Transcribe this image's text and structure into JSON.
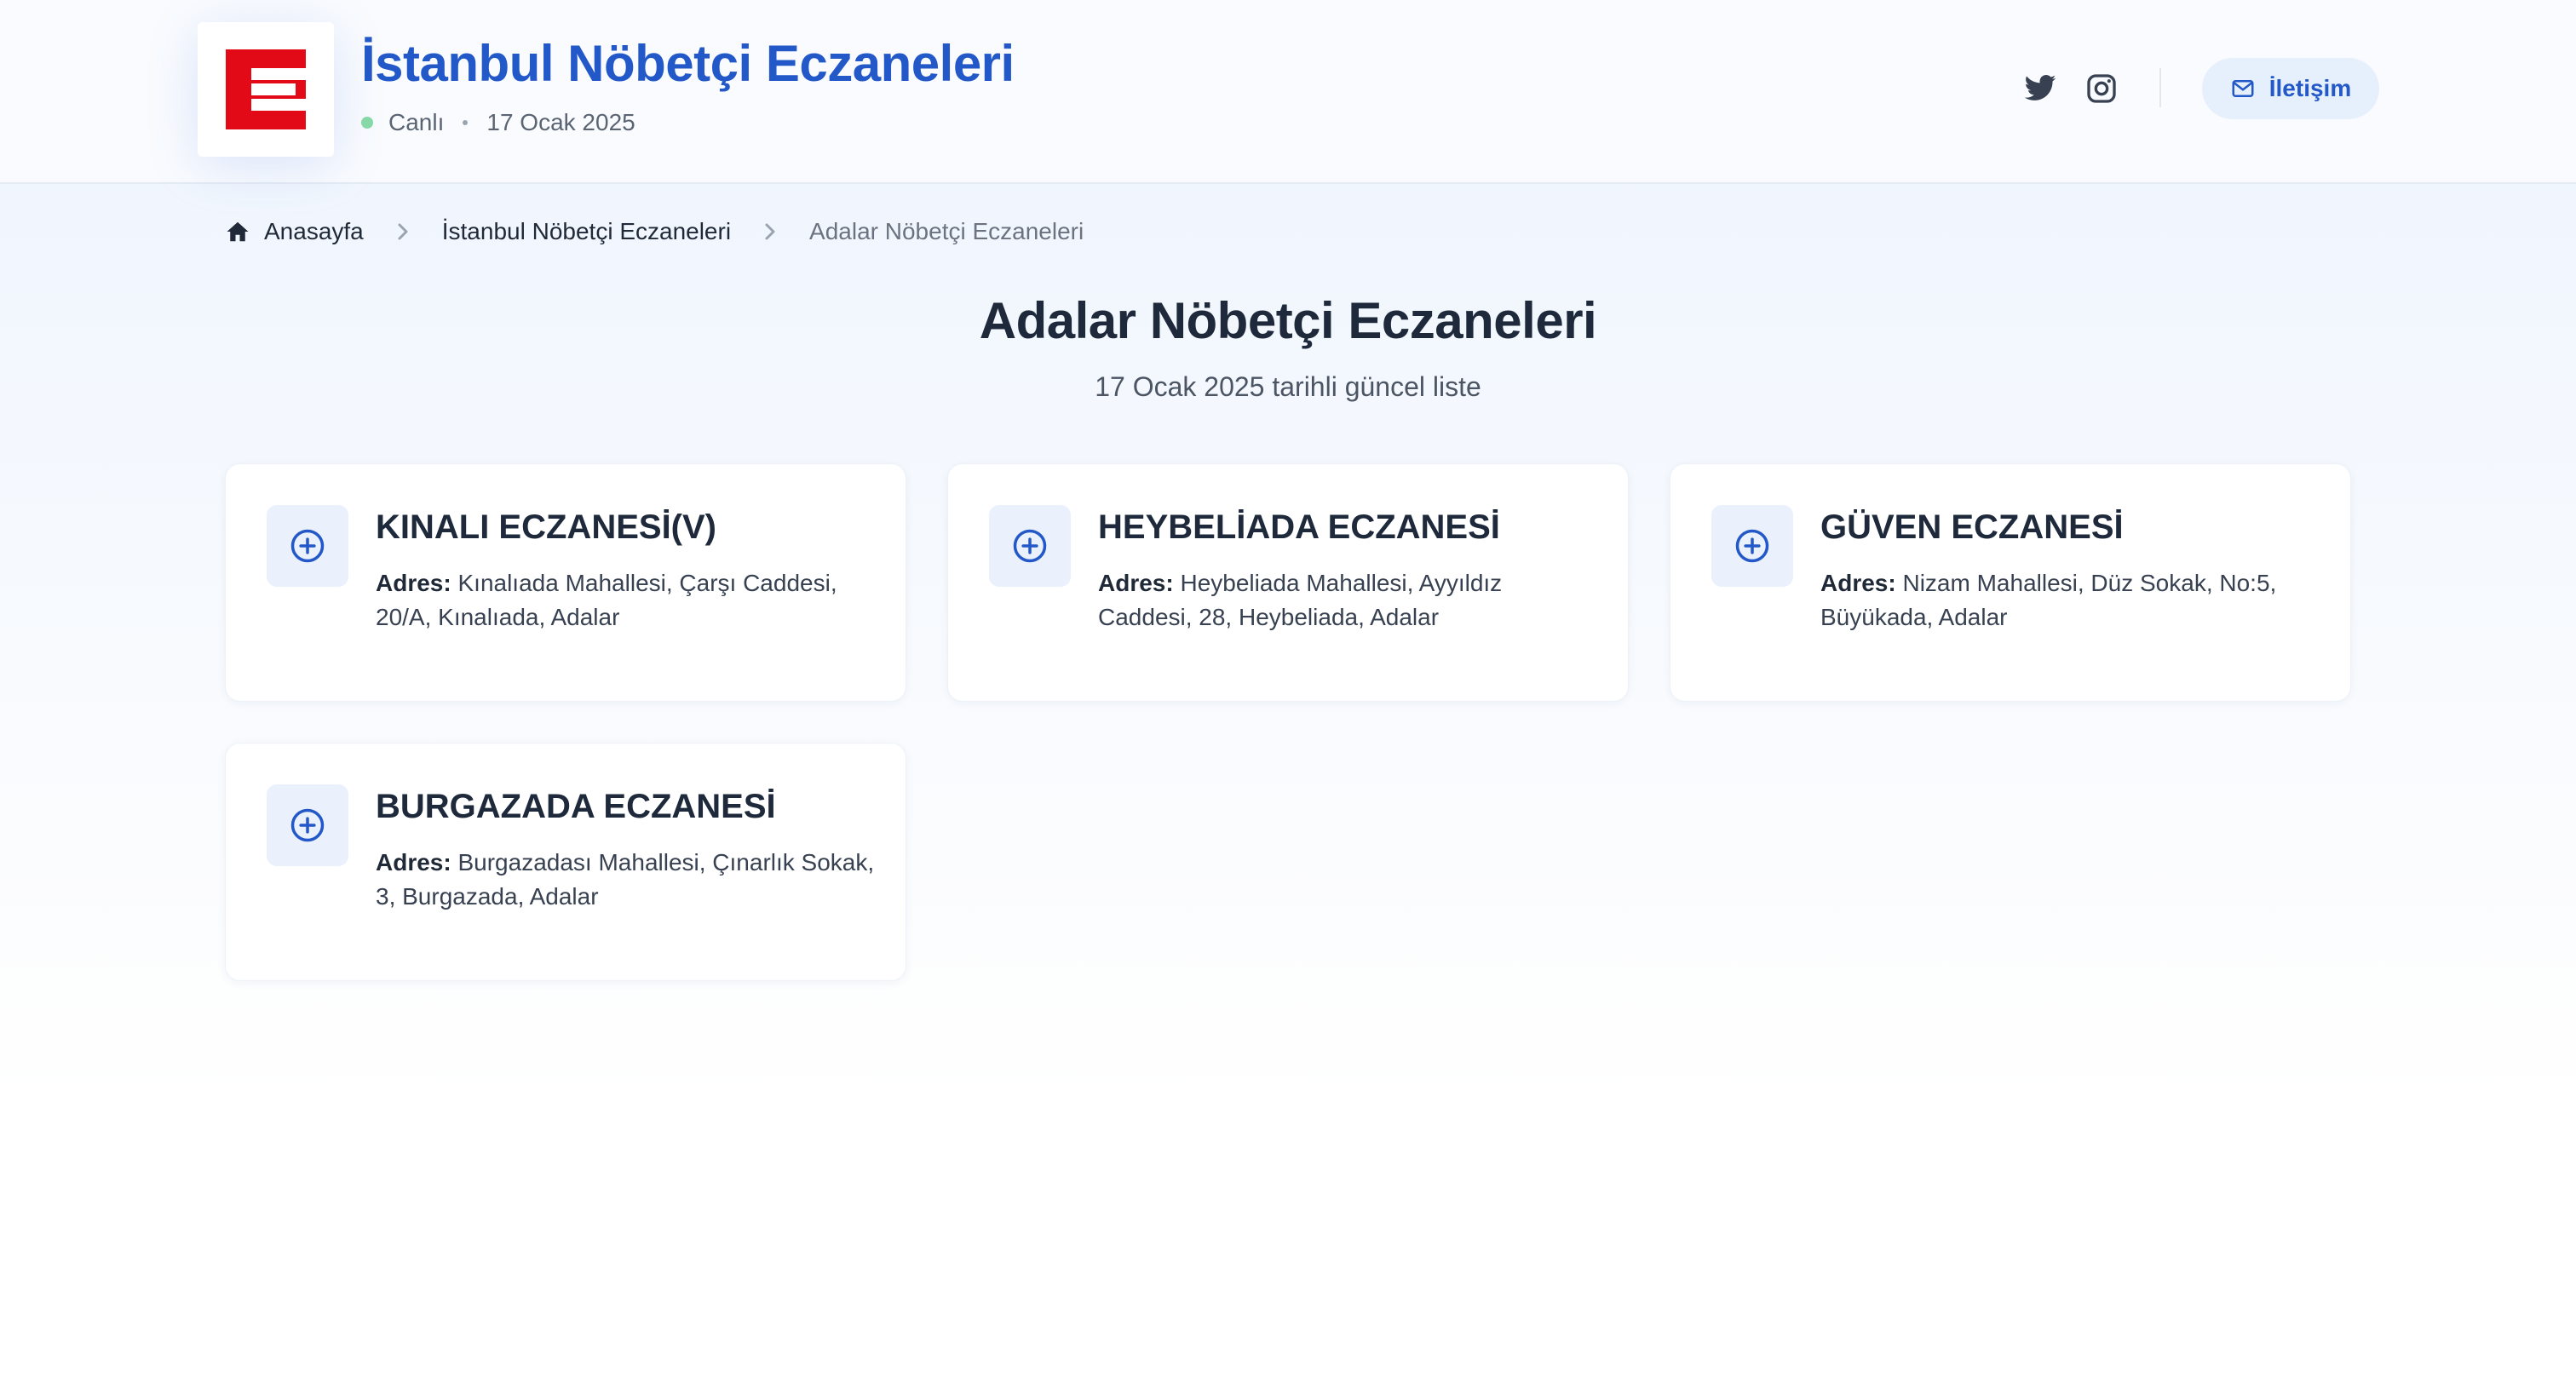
{
  "header": {
    "logo_letter": "E",
    "site_title": "İstanbul Nöbetçi Eczaneleri",
    "live_label": "Canlı",
    "date": "17 Ocak 2025",
    "contact_label": "İletişim",
    "colors": {
      "brand_blue": "#2358c8",
      "logo_red": "#e30a17",
      "live_green": "#86d9a6"
    }
  },
  "breadcrumb": {
    "home": "Anasayfa",
    "parent": "İstanbul Nöbetçi Eczaneleri",
    "current": "Adalar Nöbetçi Eczaneleri"
  },
  "main": {
    "title": "Adalar Nöbetçi Eczaneleri",
    "subtitle": "17 Ocak 2025 tarihli güncel liste",
    "address_label": "Adres:",
    "pharmacies": [
      {
        "name": "KINALI ECZANESİ(V)",
        "address": "Kınalıada Mahallesi, Çarşı Caddesi, 20/A, Kınalıada, Adalar"
      },
      {
        "name": "HEYBELİADA ECZANESİ",
        "address": "Heybeliada Mahallesi, Ayyıldız Caddesi, 28, Heybeliada, Adalar"
      },
      {
        "name": "GÜVEN ECZANESİ",
        "address": "Nizam Mahallesi, Düz Sokak, No:5, Büyükada, Adalar"
      },
      {
        "name": "BURGAZADA ECZANESİ",
        "address": "Burgazadası Mahallesi, Çınarlık Sokak, 3, Burgazada, Adalar"
      }
    ]
  },
  "icons": {
    "home": "home-icon",
    "chevron": "chevron-right-icon",
    "twitter": "twitter-icon",
    "instagram": "instagram-icon",
    "mail": "mail-icon",
    "pharmacy": "plus-circle-icon"
  }
}
